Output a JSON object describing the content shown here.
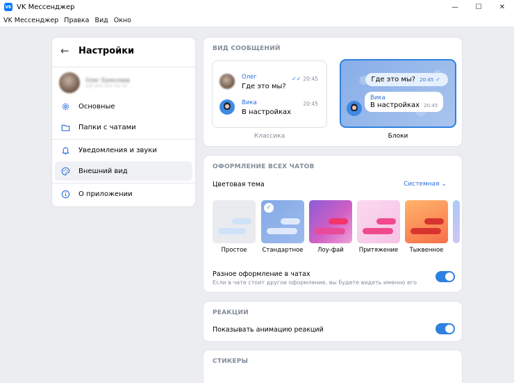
{
  "window": {
    "title": "VK Мессенджер",
    "controls": {
      "minimize": "—",
      "maximize": "☐",
      "close": "✕"
    }
  },
  "menu": [
    "VK Мессенджер",
    "Правка",
    "Вид",
    "Окно"
  ],
  "sidebar": {
    "title": "Настройки",
    "profile": {
      "name": "Олег Ермолаев",
      "subtitle": "+7 ••• ••• •• ••"
    },
    "items": [
      {
        "label": "Основные",
        "icon": "gear-icon"
      },
      {
        "label": "Папки с чатами",
        "icon": "folder-icon"
      },
      {
        "label": "Уведомления и звуки",
        "icon": "bell-icon"
      },
      {
        "label": "Внешний вид",
        "icon": "palette-icon",
        "active": true
      },
      {
        "label": "О приложении",
        "icon": "info-icon"
      }
    ]
  },
  "message_style": {
    "title": "ВИД СООБЩЕНИЙ",
    "classic": {
      "label": "Классика",
      "messages": [
        {
          "name": "Олег",
          "text": "Где это мы?",
          "time": "20:45"
        },
        {
          "name": "Вика",
          "text": "В настройках",
          "time": "20:45"
        }
      ]
    },
    "blocks": {
      "label": "Блоки",
      "out_text": "Где это мы?",
      "out_time": "20:45",
      "in_name": "Вика",
      "in_text": "В настройках",
      "in_time": "20:45"
    }
  },
  "design": {
    "title": "ОФОРМЛЕНИЕ ВСЕХ ЧАТОВ",
    "theme_label": "Цветовая тема",
    "theme_value": "Системная",
    "themes": [
      "Простое",
      "Стандартное",
      "Лоу-фай",
      "Притяжение",
      "Тыквенное"
    ],
    "selected_theme": "Стандартное",
    "diff_title": "Разное оформление в чатах",
    "diff_sub": "Если в чате стоит другое оформление, вы будете видеть именно его",
    "diff_enabled": true
  },
  "reactions": {
    "title": "РЕАКЦИИ",
    "label": "Показывать анимацию реакций",
    "enabled": true
  },
  "stickers": {
    "title": "СТИКЕРЫ"
  },
  "colors": {
    "accent": "#2d81e0",
    "background": "#ebedf0"
  }
}
